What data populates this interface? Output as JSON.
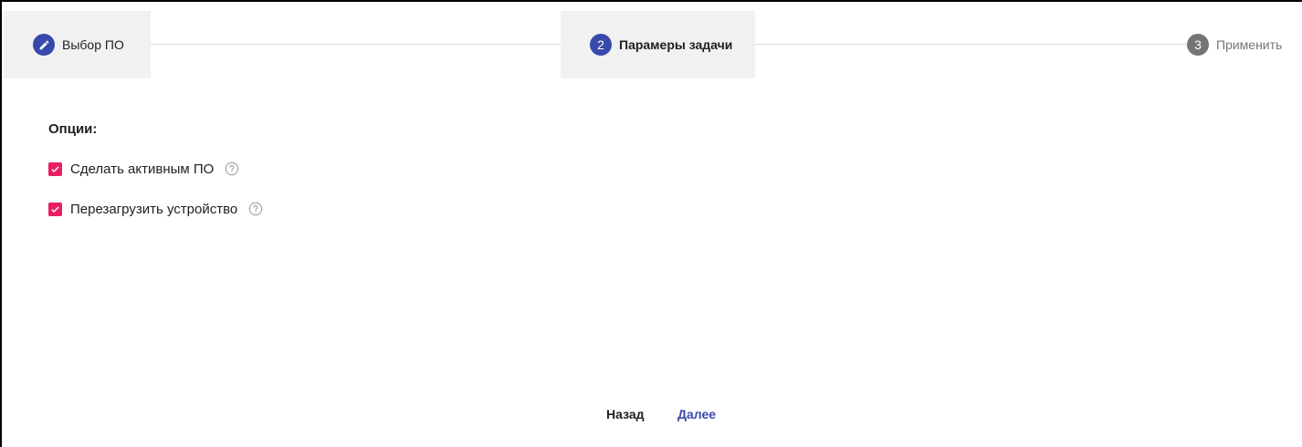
{
  "stepper": {
    "steps": [
      {
        "number": "",
        "label": "Выбор ПО",
        "state": "done",
        "icon": "pencil-icon"
      },
      {
        "number": "2",
        "label": "Парамеры задачи",
        "state": "active"
      },
      {
        "number": "3",
        "label": "Применить",
        "state": "pending"
      }
    ]
  },
  "options": {
    "title": "Опции:",
    "items": [
      {
        "label": "Сделать активным ПО",
        "checked": true,
        "help_icon": "help-circle-icon"
      },
      {
        "label": "Перезагрузить устройство",
        "checked": true,
        "help_icon": "help-circle-icon"
      }
    ]
  },
  "footer": {
    "back_label": "Назад",
    "next_label": "Далее"
  },
  "colors": {
    "accent": "#3949ab",
    "checkbox": "#e91e63",
    "pending_step": "#757575",
    "active_step_bg": "#f1f1f1"
  }
}
